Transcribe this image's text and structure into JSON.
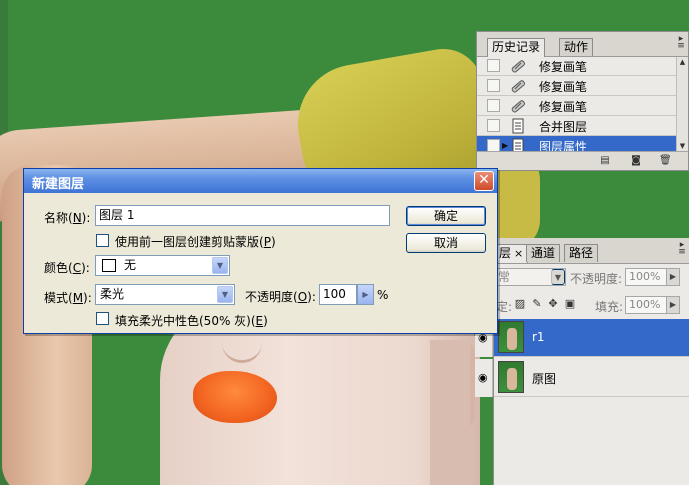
{
  "history_panel": {
    "tabs": [
      {
        "label": "历史记录"
      },
      {
        "label": "动作"
      }
    ],
    "tab_close": "×",
    "items": [
      {
        "label": "修复画笔",
        "icon": "healing-brush-icon"
      },
      {
        "label": "修复画笔",
        "icon": "healing-brush-icon"
      },
      {
        "label": "修复画笔",
        "icon": "healing-brush-icon"
      },
      {
        "label": "合并图层",
        "icon": "merge-layers-icon"
      },
      {
        "label": "图层属性",
        "icon": "layer-properties-icon",
        "selected": true
      }
    ],
    "footer_icons": [
      "new-document-from-state-icon",
      "snapshot-camera-icon",
      "trash-icon"
    ]
  },
  "layers_panel": {
    "tabs": [
      {
        "label": "层"
      },
      {
        "label": "通道"
      },
      {
        "label": "路径"
      }
    ],
    "tab_close": "×",
    "blend_mode_placeholder": "常",
    "opacity_label": "不透明度:",
    "opacity_value": "100%",
    "lock_label": "定:",
    "fill_label": "填充:",
    "fill_value": "100%",
    "layers": [
      {
        "name": "r1",
        "selected": true
      },
      {
        "name": "原图",
        "selected": false
      }
    ]
  },
  "dialog": {
    "title": "新建图层",
    "close_glyph": "✕",
    "name_label": "名称(",
    "name_key": "N",
    "name_value": "图层 1",
    "clip_label": "使用前一图层创建剪贴蒙版(",
    "clip_key": "P",
    "color_label": "颜色(",
    "color_key": "C",
    "color_value": "无",
    "mode_label": "模式(",
    "mode_key": "M",
    "mode_value": "柔光",
    "opacity_label": "不透明度(",
    "opacity_key": "O",
    "opacity_value": "100",
    "percent": "%",
    "fill_neutral_label": "填充柔光中性色(50% 灰)(",
    "fill_neutral_key": "E",
    "ok_label": "确定",
    "cancel_label": "取消"
  },
  "colors": {
    "canvas_green": "#3c8a3c",
    "selection_blue": "#3469c9",
    "lip_orange": "#f26420",
    "glove_yellow": "#c8bb45"
  }
}
